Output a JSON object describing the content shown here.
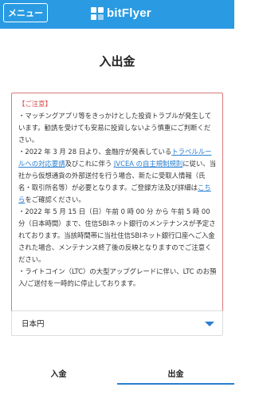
{
  "header": {
    "menu_label": "メニュー",
    "logo_text": "bitFlyer",
    "logo_icon": "bitflyer-logo-icon",
    "background": "#2a9be3"
  },
  "page_title": "入出金",
  "notice": {
    "heading": "【ご注意】",
    "p1": "・マッチングアプリ等をきっかけとした投資トラブルが発生しています。勧誘を受けても安易に投資しないよう慎重にご判断ください。",
    "p2_pre": "・2022 年 3 月 28 日より、金融庁が発表している",
    "p2_link1": "トラベルルールへの対応要請",
    "p2_mid": "及びこれに伴う ",
    "p2_link2": "JVCEA の自主規制規則",
    "p2_post": "に従い、当社から仮想通貨の外部送付を行う場合、新たに受取人情報（氏名・取引所名等）が必要となります。ご登録方法及び詳細は",
    "p2_link3": "こちら",
    "p2_end": "をご確認ください。",
    "p3": "・2022 年 5 月 15 日（日）午前 0 時 00 分 から 午前 5 時 00 分（日本時間）まで、住信SBIネット銀行のメンテナンスが予定されております。当該時間帯に当社住信SBIネット銀行口座へご入金された場合、メンテナンス終了後の反映となりますのでご注意ください。",
    "p4": "・ライトコイン（LTC）の大型アップグレードに伴い、LTC のお預入/ご送付を一時的に停止しております。",
    "border_color": "#d9787a"
  },
  "currency_select": {
    "value": "日本円"
  },
  "tabs": [
    {
      "label": "入金",
      "active": false
    },
    {
      "label": "出金",
      "active": true
    }
  ],
  "accent": "#2a7fd0"
}
